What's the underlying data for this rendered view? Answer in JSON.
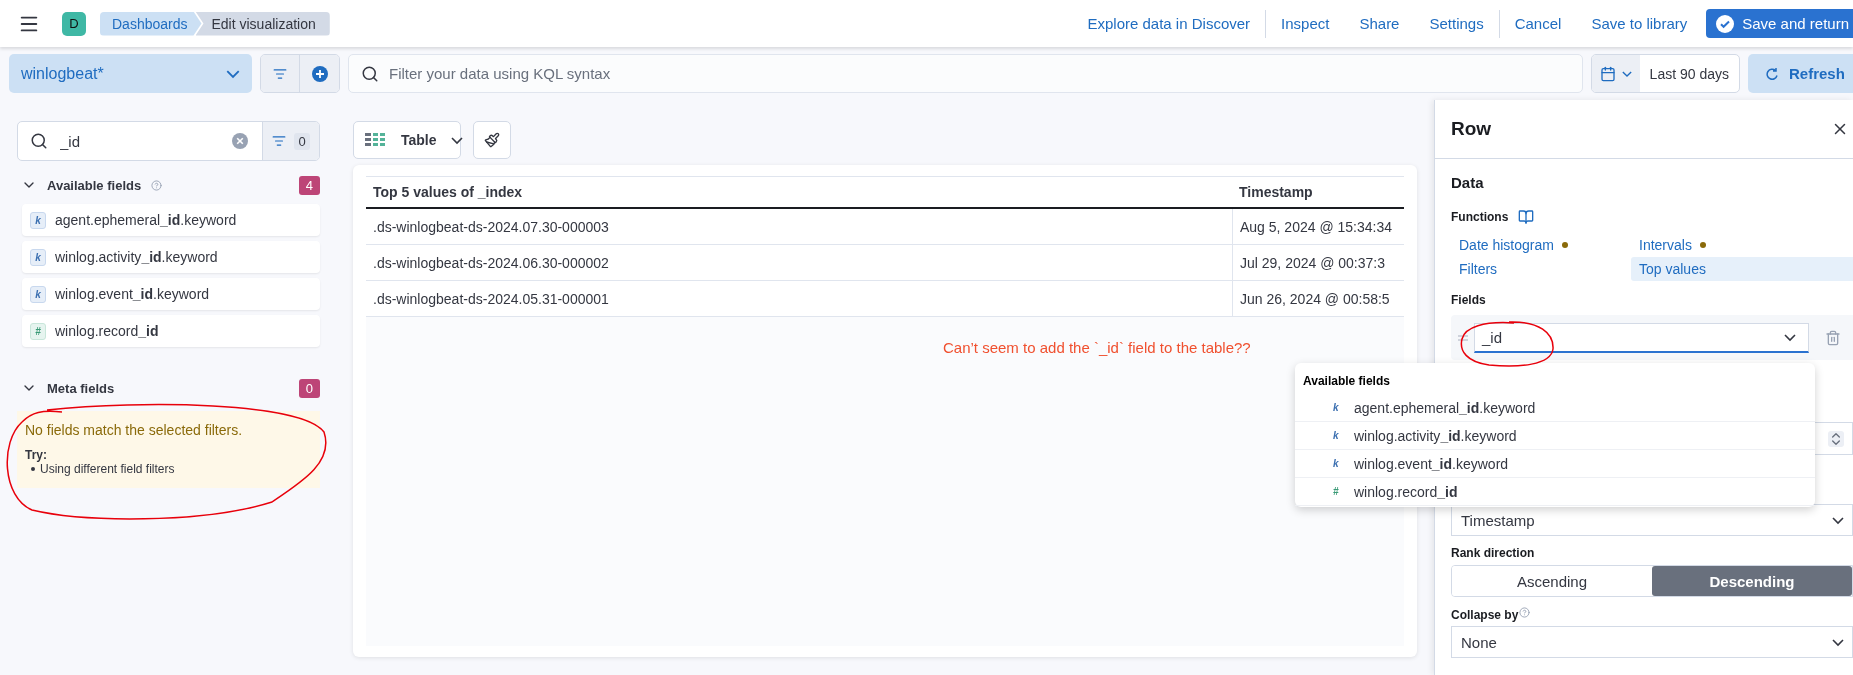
{
  "header": {
    "avatar": "D",
    "breadcrumbs": [
      {
        "label": "Dashboards",
        "selected": false
      },
      {
        "label": "Edit visualization",
        "selected": true
      }
    ],
    "links": [
      "Explore data in Discover",
      "Inspect",
      "Share",
      "Settings",
      "Cancel",
      "Save to library"
    ],
    "primary_button": "Save and return"
  },
  "query_bar": {
    "data_view": "winlogbeat*",
    "placeholder": "Filter your data using KQL syntax",
    "date_range": "Last 90 days",
    "refresh": "Refresh"
  },
  "sidebar": {
    "search": {
      "value": "_id"
    },
    "filter_count": "0",
    "sections": [
      {
        "title": "Available fields",
        "count": "4",
        "expanded": true,
        "fields": [
          {
            "kind": "keyword",
            "icon": "k",
            "name": "agent.ephemeral**_id**.keyword"
          },
          {
            "kind": "keyword",
            "icon": "k",
            "name": "winlog.activity**_id**.keyword"
          },
          {
            "kind": "keyword",
            "icon": "k",
            "name": "winlog.event**_id**.keyword"
          },
          {
            "kind": "number",
            "icon": "#",
            "name": "winlog.record**_id**"
          }
        ]
      },
      {
        "title": "Meta fields",
        "count": "0",
        "expanded": true,
        "empty": {
          "message": "No fields match the selected filters.",
          "try_label": "Try:",
          "suggestions": [
            "Using different field filters"
          ]
        }
      }
    ]
  },
  "workspace": {
    "chart_type": "Table",
    "table": {
      "columns": [
        "Top 5 values of _index",
        "Timestamp"
      ],
      "rows": [
        [
          ".ds-winlogbeat-ds-2024.07.30-000003",
          "Aug 5, 2024 @ 15:34:34"
        ],
        [
          ".ds-winlogbeat-ds-2024.06.30-000002",
          "Jul 29, 2024 @ 00:37:3"
        ],
        [
          ".ds-winlogbeat-ds-2024.05.31-000001",
          "Jun 26, 2024 @ 00:58:5"
        ]
      ]
    },
    "annotation": "Can’t seem to add the `_id` field to the table??"
  },
  "panel": {
    "title": "Row",
    "section": "Data",
    "functions_label": "Functions",
    "functions": [
      {
        "label": "Date histogram",
        "dot": true,
        "selected": false
      },
      {
        "label": "Intervals",
        "dot": true,
        "selected": false
      },
      {
        "label": "Filters",
        "dot": false,
        "selected": false
      },
      {
        "label": "Top values",
        "dot": false,
        "selected": true
      }
    ],
    "fields_label": "Fields",
    "field_value": "_id",
    "rank_by_value": "Timestamp",
    "rank_direction_label": "Rank direction",
    "rank_direction": [
      {
        "label": "Ascending",
        "selected": false
      },
      {
        "label": "Descending",
        "selected": true
      }
    ],
    "collapse_label": "Collapse by",
    "collapse_value": "None"
  },
  "dropdown": {
    "title": "Available fields",
    "options": [
      {
        "kind": "keyword",
        "icon": "k",
        "name": "agent.ephemeral**_id**.keyword"
      },
      {
        "kind": "keyword",
        "icon": "k",
        "name": "winlog.activity**_id**.keyword"
      },
      {
        "kind": "keyword",
        "icon": "k",
        "name": "winlog.event**_id**.keyword"
      },
      {
        "kind": "number",
        "icon": "#",
        "name": "winlog.record**_id**"
      }
    ]
  }
}
